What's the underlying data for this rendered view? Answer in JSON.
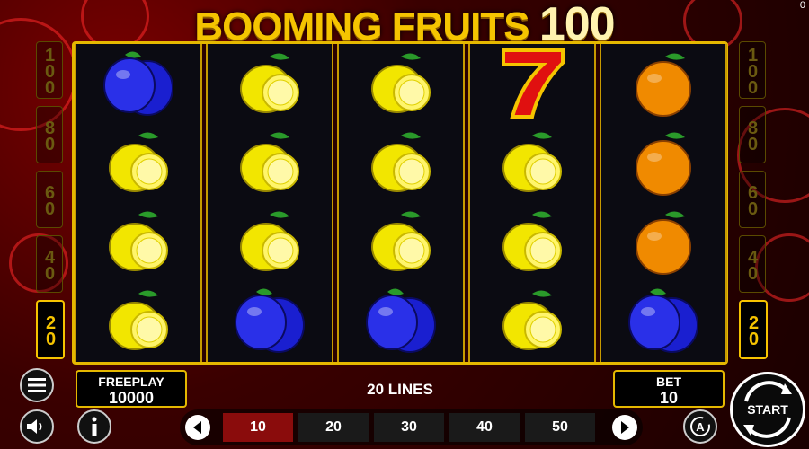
{
  "title": {
    "main": "BOOMING FRUITS",
    "number": "100"
  },
  "version": "0",
  "lines_left": [
    {
      "label": "100",
      "active": false
    },
    {
      "label": "80",
      "active": false
    },
    {
      "label": "60",
      "active": false
    },
    {
      "label": "40",
      "active": false
    },
    {
      "label": "20",
      "active": true
    }
  ],
  "lines_right": [
    {
      "label": "100",
      "active": false
    },
    {
      "label": "80",
      "active": false
    },
    {
      "label": "60",
      "active": false
    },
    {
      "label": "40",
      "active": false
    },
    {
      "label": "20",
      "active": true
    }
  ],
  "reels": [
    [
      "plum",
      "lemon",
      "lemon",
      "lemon"
    ],
    [
      "lemon",
      "lemon",
      "lemon",
      "plum"
    ],
    [
      "lemon",
      "lemon",
      "lemon",
      "plum"
    ],
    [
      "seven",
      "lemon",
      "lemon",
      "lemon"
    ],
    [
      "orange",
      "orange",
      "orange",
      "plum"
    ]
  ],
  "balance": {
    "label": "FREEPLAY",
    "value": "10000"
  },
  "lines_info": "20 LINES",
  "bet": {
    "label": "BET",
    "value": "10"
  },
  "line_options": [
    {
      "label": "10",
      "selected": true
    },
    {
      "label": "20",
      "selected": false
    },
    {
      "label": "30",
      "selected": false
    },
    {
      "label": "40",
      "selected": false
    },
    {
      "label": "50",
      "selected": false
    }
  ],
  "start_label": "START",
  "icons": {
    "menu": "menu-icon",
    "sound": "speaker-icon",
    "info": "info-icon",
    "autoplay": "autoplay-icon",
    "prev": "chevron-left-icon",
    "next": "chevron-right-icon"
  },
  "colors": {
    "gold": "#f5c400",
    "selected": "#8a0c0c",
    "plum": "#1a1fd0",
    "lemon": "#f2e600",
    "orange": "#f08a00",
    "seven": "#e01010"
  }
}
